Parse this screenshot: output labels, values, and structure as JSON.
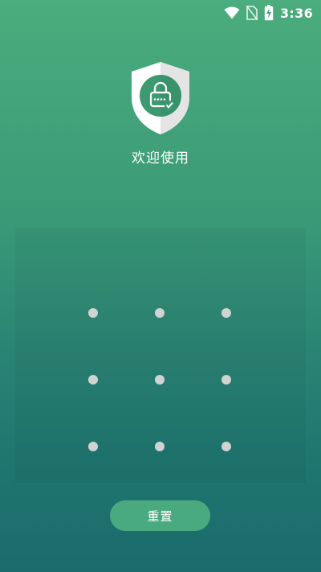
{
  "status_bar": {
    "time": "3:36",
    "icons": [
      "wifi-icon",
      "no-sim-icon",
      "battery-charging-icon"
    ]
  },
  "header": {
    "logo_icon": "shield-lock-icon",
    "welcome_text": "欢迎使用"
  },
  "pattern_lock": {
    "grid": [
      3,
      3
    ]
  },
  "actions": {
    "reset_label": "重置"
  },
  "colors": {
    "gradient_top": "#4bac7d",
    "gradient_bottom": "#1b6b6c",
    "button_bg": "#4aaa7f",
    "dot": "#cfd3d2",
    "shield_light": "#ffffff",
    "shield_shade": "#e6e6e6",
    "shield_inner": "#3d9a70"
  }
}
